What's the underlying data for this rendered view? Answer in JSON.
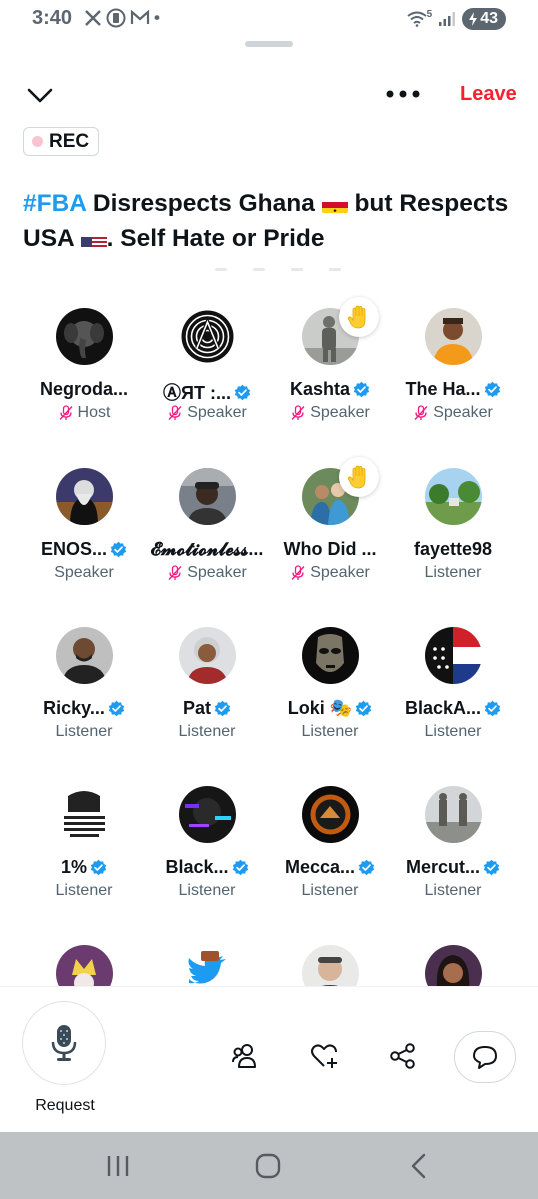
{
  "status": {
    "time": "3:40",
    "left_icons": [
      "x-logo-icon",
      "sim-icon",
      "gmail-icon",
      "dot-icon"
    ],
    "network": "5",
    "battery": "43"
  },
  "header": {
    "leave_label": "Leave",
    "rec_label": "REC"
  },
  "space": {
    "title_hashtag": "#FBA",
    "title_part1": " Disrespects Ghana ",
    "title_part2": " but Respects USA ",
    "title_part3": ".  Self Hate or Pride"
  },
  "participants": [
    {
      "name": "Negroda...",
      "role": "Host",
      "verified": false,
      "muted": true,
      "hand": false,
      "avatar": "elephant"
    },
    {
      "name": "ⒶЯT :...",
      "role": "Speaker",
      "verified": true,
      "muted": true,
      "hand": false,
      "avatar": "maze"
    },
    {
      "name": "Kashta",
      "role": "Speaker",
      "verified": true,
      "muted": true,
      "hand": true,
      "avatar": "statue"
    },
    {
      "name": "The Ha...",
      "role": "Speaker",
      "verified": true,
      "muted": true,
      "hand": false,
      "avatar": "orange-shirt"
    },
    {
      "name": "ENOS...",
      "role": "Speaker",
      "verified": true,
      "muted": false,
      "hand": false,
      "avatar": "bearded"
    },
    {
      "name": "𝓔𝓶𝓸𝓽𝓲𝓸𝓷𝓵𝓮𝓼𝓼...",
      "role": "Speaker",
      "verified": false,
      "muted": true,
      "hand": false,
      "avatar": "man-car"
    },
    {
      "name": "Who Did ...",
      "role": "Speaker",
      "verified": false,
      "muted": true,
      "hand": true,
      "avatar": "group"
    },
    {
      "name": "fayette98",
      "role": "Listener",
      "verified": false,
      "muted": false,
      "hand": false,
      "avatar": "park"
    },
    {
      "name": "Ricky...",
      "role": "Listener",
      "verified": true,
      "muted": false,
      "hand": false,
      "avatar": "bald-man"
    },
    {
      "name": "Pat",
      "role": "Listener",
      "verified": true,
      "muted": false,
      "hand": false,
      "avatar": "woman-gray"
    },
    {
      "name": "Loki 🎭",
      "role": "Listener",
      "verified": true,
      "muted": false,
      "hand": false,
      "avatar": "mask"
    },
    {
      "name": "BlackA...",
      "role": "Listener",
      "verified": true,
      "muted": false,
      "hand": false,
      "avatar": "flag"
    },
    {
      "name": "1%",
      "role": "Listener",
      "verified": true,
      "muted": false,
      "hand": false,
      "avatar": "poster"
    },
    {
      "name": "Black...",
      "role": "Listener",
      "verified": true,
      "muted": false,
      "hand": false,
      "avatar": "glitch"
    },
    {
      "name": "Mecca...",
      "role": "Listener",
      "verified": true,
      "muted": false,
      "hand": false,
      "avatar": "emblem"
    },
    {
      "name": "Mercut...",
      "role": "Listener",
      "verified": true,
      "muted": false,
      "hand": false,
      "avatar": "statue2"
    },
    {
      "name": "",
      "role": "",
      "verified": false,
      "muted": false,
      "hand": false,
      "avatar": "cartoon"
    },
    {
      "name": "",
      "role": "",
      "verified": false,
      "muted": false,
      "hand": false,
      "avatar": "twitter-bird"
    },
    {
      "name": "",
      "role": "",
      "verified": false,
      "muted": false,
      "hand": false,
      "avatar": "man-light"
    },
    {
      "name": "",
      "role": "",
      "verified": false,
      "muted": false,
      "hand": false,
      "avatar": "woman-dark"
    }
  ],
  "bottom": {
    "request_label": "Request",
    "actions": [
      "people-icon",
      "heart-plus-icon",
      "share-icon",
      "chat-icon"
    ]
  },
  "colors": {
    "accent": "#1d9bf0",
    "leave": "#f4212e",
    "muted_mic": "#f91880",
    "secondary_text": "#536471"
  }
}
